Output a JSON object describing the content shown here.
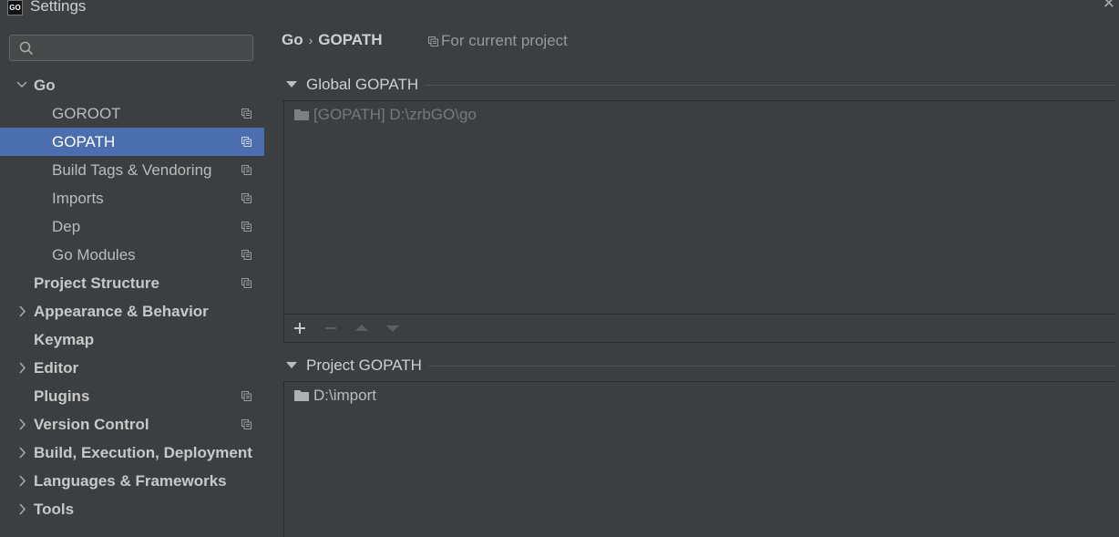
{
  "window": {
    "title": "Settings",
    "app_icon_text": "GO"
  },
  "search": {
    "placeholder": "",
    "value": ""
  },
  "sidebar": {
    "items": [
      {
        "label": "Go",
        "expanded": true
      },
      {
        "label": "GOROOT"
      },
      {
        "label": "GOPATH",
        "selected": true
      },
      {
        "label": "Build Tags & Vendoring"
      },
      {
        "label": "Imports"
      },
      {
        "label": "Dep"
      },
      {
        "label": "Go Modules"
      },
      {
        "label": "Project Structure"
      },
      {
        "label": "Appearance & Behavior"
      },
      {
        "label": "Keymap"
      },
      {
        "label": "Editor"
      },
      {
        "label": "Plugins"
      },
      {
        "label": "Version Control"
      },
      {
        "label": "Build, Execution, Deployment"
      },
      {
        "label": "Languages & Frameworks"
      },
      {
        "label": "Tools"
      }
    ]
  },
  "breadcrumb": {
    "parent": "Go",
    "separator": "›",
    "current": "GOPATH"
  },
  "scope_note": "For current project",
  "global_section": {
    "title": "Global GOPATH",
    "items": [
      {
        "text": "[GOPATH] D:\\zrbGO\\go"
      }
    ]
  },
  "project_section": {
    "title": "Project GOPATH",
    "items": [
      {
        "text": "D:\\import"
      }
    ]
  },
  "colors": {
    "background": "#3c3f41",
    "selection": "#4b6eaf",
    "text": "#bbbbbb"
  },
  "icons": [
    "search-icon",
    "chevron-down-icon",
    "chevron-right-icon",
    "project-scope-icon",
    "folder-icon",
    "add-icon",
    "remove-icon",
    "move-up-icon",
    "move-down-icon",
    "close-icon"
  ]
}
